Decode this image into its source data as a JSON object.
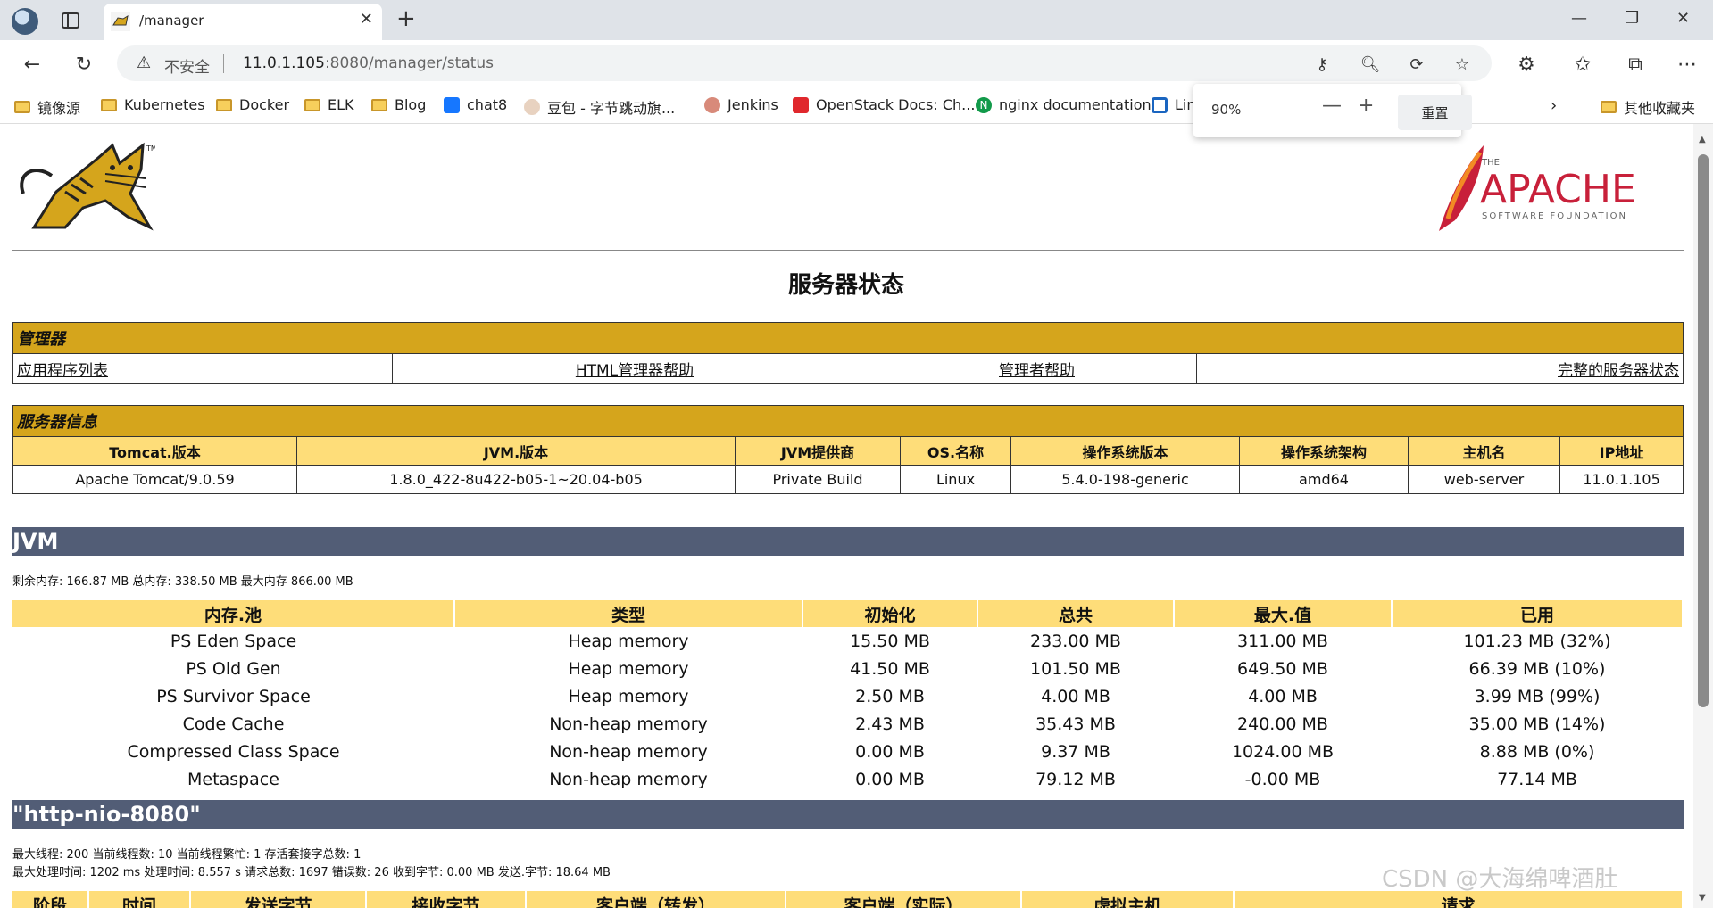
{
  "browser": {
    "tab_title": "/manager",
    "address": {
      "insecure_label": "不安全",
      "url_host": "11.0.1.105",
      "url_rest": ":8080/manager/status"
    },
    "bookmarks": [
      {
        "label": "镜像源",
        "icon": "folder-icon"
      },
      {
        "label": "Kubernetes",
        "icon": "folder-icon"
      },
      {
        "label": "Docker",
        "icon": "folder-icon"
      },
      {
        "label": "ELK",
        "icon": "folder-icon"
      },
      {
        "label": "Blog",
        "icon": "folder-icon"
      },
      {
        "label": "chat8",
        "icon": "chat-icon"
      },
      {
        "label": "豆包 - 字节跳动旗...",
        "icon": "doubao-icon"
      },
      {
        "label": "Jenkins",
        "icon": "jenkins-icon"
      },
      {
        "label": "OpenStack Docs: Ch...",
        "icon": "openstack-icon"
      },
      {
        "label": "nginx documentation",
        "icon": "nginx-icon"
      },
      {
        "label": "Lin",
        "icon": "linux-icon"
      }
    ],
    "other_bookmarks": "其他收藏夹",
    "zoom_popup": {
      "percent": "90%",
      "minus": "—",
      "plus": "+",
      "reset": "重置"
    }
  },
  "page": {
    "title": "服务器状态",
    "manager": {
      "header": "管理器",
      "links": [
        "应用程序列表",
        "HTML管理器帮助",
        "管理者帮助",
        "完整的服务器状态"
      ]
    },
    "server_info": {
      "header": "服务器信息",
      "columns": [
        "Tomcat.版本",
        "JVM.版本",
        "JVM提供商",
        "OS.名称",
        "操作系统版本",
        "操作系统架构",
        "主机名",
        "IP地址"
      ],
      "values": [
        "Apache Tomcat/9.0.59",
        "1.8.0_422-8u422-b05-1~20.04-b05",
        "Private Build",
        "Linux",
        "5.4.0-198-generic",
        "amd64",
        "web-server",
        "11.0.1.105"
      ]
    },
    "jvm": {
      "title": "JVM",
      "memory_line": "剩余内存:  166.87 MB 总内存:  338.50 MB 最大内存 866.00 MB",
      "columns": [
        "内存.池",
        "类型",
        "初始化",
        "总共",
        "最大.值",
        "已用"
      ],
      "rows": [
        [
          "PS Eden Space",
          "Heap memory",
          "15.50 MB",
          "233.00 MB",
          "311.00 MB",
          "101.23 MB (32%)"
        ],
        [
          "PS Old Gen",
          "Heap memory",
          "41.50 MB",
          "101.50 MB",
          "649.50 MB",
          "66.39 MB (10%)"
        ],
        [
          "PS Survivor Space",
          "Heap memory",
          "2.50 MB",
          "4.00 MB",
          "4.00 MB",
          "3.99 MB (99%)"
        ],
        [
          "Code Cache",
          "Non-heap memory",
          "2.43 MB",
          "35.43 MB",
          "240.00 MB",
          "35.00 MB (14%)"
        ],
        [
          "Compressed Class Space",
          "Non-heap memory",
          "0.00 MB",
          "9.37 MB",
          "1024.00 MB",
          "8.88 MB (0%)"
        ],
        [
          "Metaspace",
          "Non-heap memory",
          "0.00 MB",
          "79.12 MB",
          "-0.00 MB",
          "77.14 MB"
        ]
      ]
    },
    "connector": {
      "title": "\"http-nio-8080\"",
      "line1": "最大线程:  200 当前线程数:  10 当前线程繁忙:  1 存活套接字总数:  1",
      "line2": "最大处理时间:  1202 ms 处理时间:  8.557 s 请求总数:  1697 错误数:  26 收到字节:  0.00 MB 发送.字节: 18.64 MB",
      "columns": [
        "阶段",
        "时间",
        "发送字节",
        "接收字节",
        "客户端（转发）",
        "客户端（实际）",
        "虚拟主机",
        "请求"
      ]
    },
    "logos": {
      "apache_small": "THE",
      "apache_big": "APACHE",
      "apache_sub": "SOFTWARE FOUNDATION",
      "tomcat_tm": "TM"
    }
  },
  "watermark": "CSDN @大海绵啤酒肚",
  "colors": {
    "gold": "#d5a51c",
    "light_gold": "#fedd79",
    "section_bar": "#525d76"
  }
}
